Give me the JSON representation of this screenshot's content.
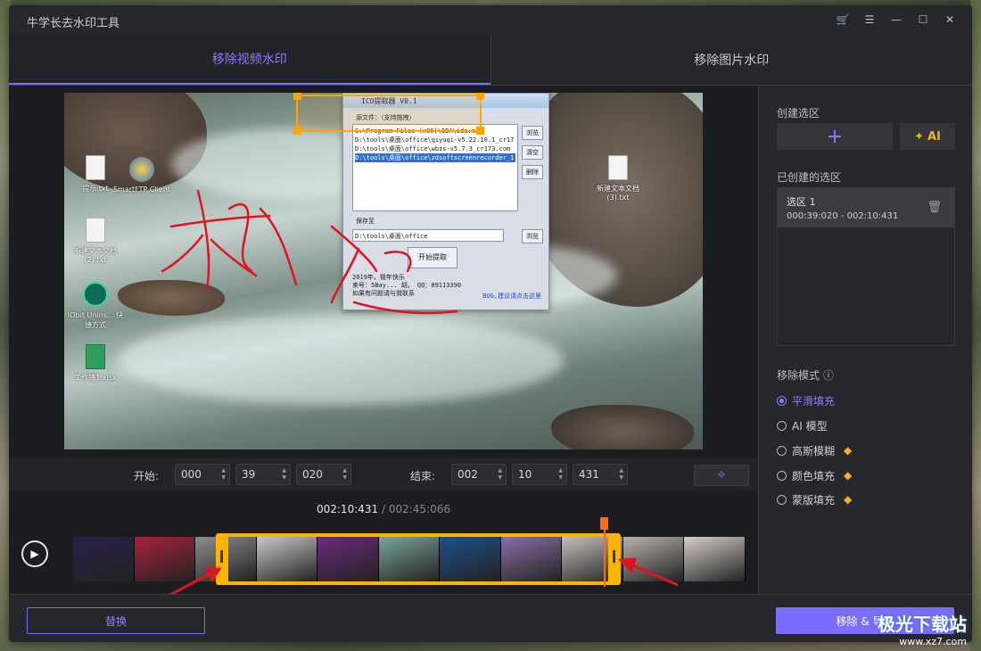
{
  "app": {
    "title": "牛学长去水印工具"
  },
  "window_controls": [
    {
      "icon": "cart-icon",
      "glyph": "🛒"
    },
    {
      "icon": "menu-icon",
      "glyph": "☰"
    },
    {
      "icon": "minimize-icon",
      "glyph": "—"
    },
    {
      "icon": "maximize-icon",
      "glyph": "☐"
    },
    {
      "icon": "close-icon",
      "glyph": "✕"
    }
  ],
  "tabs": [
    {
      "label": "移除视频水印",
      "active": true
    },
    {
      "label": "移除图片水印",
      "active": false
    }
  ],
  "preview": {
    "desktop_icons": [
      {
        "label": "提示.txt"
      },
      {
        "label": "SmartFTP Client"
      },
      {
        "label": "新建文本文档 (2).txt"
      },
      {
        "label": "IObit Unins... 快捷方式"
      },
      {
        "label": "工作簿1.xlsx"
      },
      {
        "label": "新建文本文档 (3).txt"
      }
    ],
    "ico_window": {
      "title": "ICO提取器 V0.1",
      "source_label": "源文件：（支持拖拽）",
      "files": [
        "C:\\Program Files (x86)\\IDA\\ida.exe",
        "D:\\tools\\桌面\\office\\qiyuqi-v5.22.10.1_cr17",
        "D:\\tools\\桌面\\office\\wbzs-v5.7.3_cr173.com",
        "D:\\tools\\桌面\\office\\zdsoftscreenrecorder_1"
      ],
      "btn_browse": "浏览",
      "btn_clear": "清空",
      "btn_delete": "删除",
      "save_label": "保存至",
      "save_path": "D:\\tools\\桌面\\office",
      "btn_browse2": "浏览",
      "btn_start": "开始提取",
      "footer_lines": [
        "2019年，我年快乐",
        "卖号：5Bay... 胡。 QQ：89113390",
        "如果有问题请与我联系"
      ],
      "bug_link": "BUG,建议请点击这里"
    }
  },
  "time_controls": {
    "start_label": "开始:",
    "start": {
      "h": "000",
      "m": "39",
      "ms": "020"
    },
    "end_label": "结束:",
    "end": {
      "h": "002",
      "m": "10",
      "ms": "431"
    }
  },
  "timeline": {
    "current": "002:10:431",
    "separator": " / ",
    "total": "002:45:066",
    "thumbnail_colors": [
      "#2a1f4a",
      "#a8223c",
      "#8d8d8d",
      "#c9c9c9",
      "#6b2a7a",
      "#7aa59a",
      "#1f4f8a",
      "#8a6fa8",
      "#c4c0bc",
      "#b8b2ac",
      "#d7cfc7"
    ]
  },
  "side": {
    "create_title": "创建选区",
    "ai_label": "AI",
    "created_title": "已创建的选区",
    "regions": [
      {
        "name": "选区 1",
        "time": "000:39:020 - 002:10:431"
      }
    ],
    "mode_title": "移除模式 ⓘ",
    "modes": [
      {
        "label": "平滑填充",
        "selected": true,
        "premium": false
      },
      {
        "label": "AI 模型",
        "selected": false,
        "premium": false
      },
      {
        "label": "高斯模糊",
        "selected": false,
        "premium": true
      },
      {
        "label": "颜色填充",
        "selected": false,
        "premium": true
      },
      {
        "label": "蒙版填充",
        "selected": false,
        "premium": true
      }
    ]
  },
  "footer": {
    "replace_label": "替换",
    "export_label": "移除 & 导出"
  },
  "watermark": {
    "name": "极光下载站",
    "url": "www.xz7.com"
  },
  "colors": {
    "accent": "#7b6bff",
    "selection": "#ffb400",
    "playhead": "#ff6a1a",
    "gem": "#f1b31c"
  }
}
